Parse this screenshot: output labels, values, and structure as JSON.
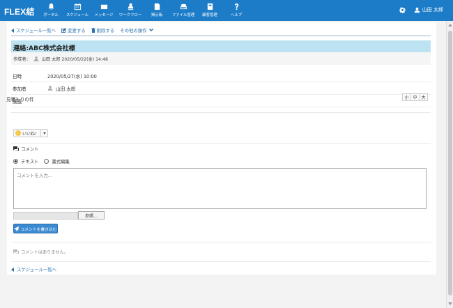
{
  "app": {
    "brand": "FLEX結"
  },
  "nav": {
    "items": [
      {
        "label": "ポータル",
        "icon": "bell-icon"
      },
      {
        "label": "スケジュール",
        "icon": "calendar-icon"
      },
      {
        "label": "メッセージ",
        "icon": "envelope-icon"
      },
      {
        "label": "ワークフロー",
        "icon": "stamp-icon"
      },
      {
        "label": "掲示板",
        "icon": "board-icon"
      },
      {
        "label": "ファイル管理",
        "icon": "drive-icon"
      },
      {
        "label": "顧客管理",
        "icon": "book-icon"
      },
      {
        "label": "ヘルプ",
        "icon": "question-icon"
      }
    ],
    "user_name": "山田 太郎"
  },
  "toolbar": {
    "back": "スケジュール一覧へ",
    "edit": "変更する",
    "delete": "削除する",
    "other": "その他の操作"
  },
  "schedule": {
    "title": "連絡:ABC株式会社様",
    "creator_label": "作成者：",
    "creator": "山田 太郎 2020/05/22(金) 14:48",
    "fields": [
      {
        "key": "日時",
        "value": "2020/05/27(水) 10:00"
      },
      {
        "key": "参加者",
        "value": "山田 太郎"
      },
      {
        "key": "施設",
        "value": ""
      }
    ],
    "subject": "見積もりの件"
  },
  "font_size": {
    "small": "小",
    "medium": "中",
    "large": "大"
  },
  "like": {
    "label": "いいね！"
  },
  "comment": {
    "heading": "コメント",
    "mode_text": "テキスト",
    "mode_rich": "書式編集",
    "placeholder": "コメントを入力...",
    "browse": "参照...",
    "submit": "コメントを書き込む",
    "empty": "コメントはありません。"
  },
  "footer": {
    "back": "スケジュール一覧へ"
  },
  "colors": {
    "nav": "#1c7cc8",
    "title_bg": "#bde3f3",
    "link": "#2a6fb0",
    "button": "#3a8ad1"
  }
}
